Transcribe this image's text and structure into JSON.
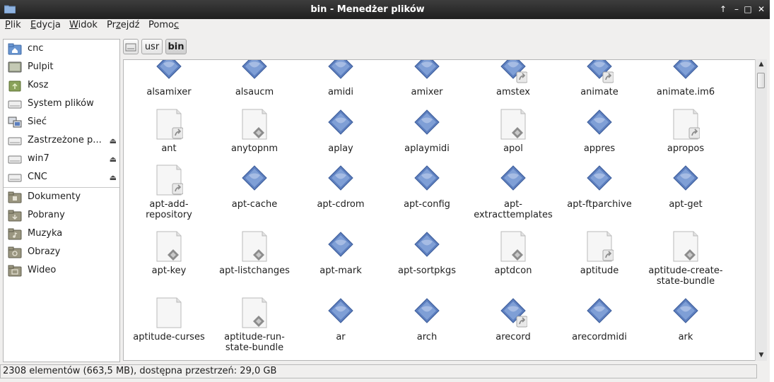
{
  "window": {
    "title": "bin - Menedżer plików",
    "buttons": {
      "up": "↑",
      "minimize": "–",
      "maximize": "□",
      "close": "✕"
    }
  },
  "menu": [
    "Plik",
    "Edycja",
    "Widok",
    "Przejdź",
    "Pomoc"
  ],
  "sidebar": {
    "devices": [
      {
        "label": "cnc",
        "icon": "home-folder-icon",
        "eject": false
      },
      {
        "label": "Pulpit",
        "icon": "desktop-icon",
        "eject": false
      },
      {
        "label": "Kosz",
        "icon": "trash-icon",
        "eject": false
      },
      {
        "label": "System plików",
        "icon": "drive-icon",
        "eject": false
      },
      {
        "label": "Sieć",
        "icon": "network-icon",
        "eject": false
      },
      {
        "label": "Zastrzeżone p...",
        "icon": "drive-icon",
        "eject": true
      },
      {
        "label": "win7",
        "icon": "drive-icon",
        "eject": true
      },
      {
        "label": "CNC",
        "icon": "drive-icon",
        "eject": true
      }
    ],
    "bookmarks": [
      {
        "label": "Dokumenty",
        "icon": "folder-documents-icon"
      },
      {
        "label": "Pobrany",
        "icon": "folder-download-icon"
      },
      {
        "label": "Muzyka",
        "icon": "folder-music-icon"
      },
      {
        "label": "Obrazy",
        "icon": "folder-pictures-icon"
      },
      {
        "label": "Wideo",
        "icon": "folder-video-icon"
      }
    ],
    "eject_glyph": "⏏"
  },
  "pathbar": {
    "root_icon": "drive-icon",
    "segments": [
      "usr",
      "bin"
    ],
    "active": "bin"
  },
  "files": [
    {
      "label": "alsamixer",
      "type": "exec"
    },
    {
      "label": "alsaucm",
      "type": "exec"
    },
    {
      "label": "amidi",
      "type": "exec"
    },
    {
      "label": "amixer",
      "type": "exec"
    },
    {
      "label": "amstex",
      "type": "exec-link"
    },
    {
      "label": "animate",
      "type": "exec-link"
    },
    {
      "label": "animate.im6",
      "type": "exec"
    },
    {
      "label": "ant",
      "type": "script-link"
    },
    {
      "label": "anytopnm",
      "type": "script"
    },
    {
      "label": "aplay",
      "type": "exec"
    },
    {
      "label": "aplaymidi",
      "type": "exec"
    },
    {
      "label": "apol",
      "type": "script"
    },
    {
      "label": "appres",
      "type": "exec"
    },
    {
      "label": "apropos",
      "type": "doc-link"
    },
    {
      "label": "apt-add-\nrepository",
      "type": "script-link"
    },
    {
      "label": "apt-cache",
      "type": "exec"
    },
    {
      "label": "apt-cdrom",
      "type": "exec"
    },
    {
      "label": "apt-config",
      "type": "exec"
    },
    {
      "label": "apt-\nextracttemplates",
      "type": "exec"
    },
    {
      "label": "apt-ftparchive",
      "type": "exec"
    },
    {
      "label": "apt-get",
      "type": "exec"
    },
    {
      "label": "apt-key",
      "type": "script"
    },
    {
      "label": "apt-listchanges",
      "type": "script"
    },
    {
      "label": "apt-mark",
      "type": "exec"
    },
    {
      "label": "apt-sortpkgs",
      "type": "exec"
    },
    {
      "label": "aptdcon",
      "type": "script"
    },
    {
      "label": "aptitude",
      "type": "doc-link"
    },
    {
      "label": "aptitude-create-\nstate-bundle",
      "type": "script"
    },
    {
      "label": "aptitude-curses",
      "type": "doc"
    },
    {
      "label": "aptitude-run-\nstate-bundle",
      "type": "script"
    },
    {
      "label": "ar",
      "type": "exec"
    },
    {
      "label": "arch",
      "type": "exec"
    },
    {
      "label": "arecord",
      "type": "exec-link"
    },
    {
      "label": "arecordmidi",
      "type": "exec"
    },
    {
      "label": "ark",
      "type": "exec"
    }
  ],
  "status": "2308 elementów (663,5 MB), dostępna przestrzeń: 29,0 GB",
  "scrollbar": {
    "up": "▲",
    "down": "▼"
  },
  "colors": {
    "titlebar": "#2a2a2a",
    "exec_blue": "#5d7fbf",
    "window_bg": "#f0efee"
  }
}
